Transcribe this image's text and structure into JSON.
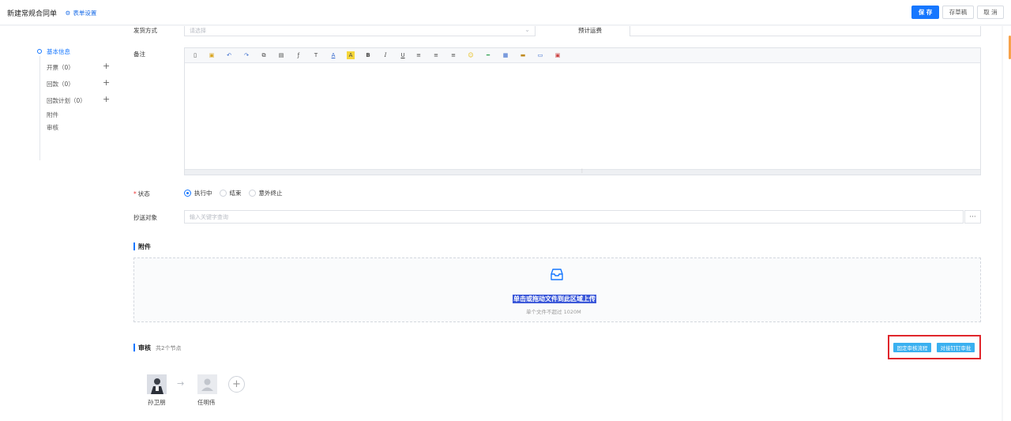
{
  "header": {
    "title": "新建常规合同单",
    "settings_link": "表单设置",
    "save_label": "保 存",
    "draft_label": "存草稿",
    "cancel_label": "取 消"
  },
  "sidebar": {
    "items": [
      {
        "label": "基本信息",
        "active": true
      },
      {
        "label": "开票（0）",
        "addable": true
      },
      {
        "label": "回款（0）",
        "addable": true
      },
      {
        "label": "回款计划（0）",
        "addable": true
      },
      {
        "label": "附件"
      },
      {
        "label": "审核"
      }
    ]
  },
  "form": {
    "shipping_label": "发货方式",
    "shipping_placeholder": "请选择",
    "estimate_label": "预计运费",
    "remark_label": "备注",
    "status_label": "状态",
    "status_options": [
      "执行中",
      "结束",
      "意外终止"
    ],
    "status_selected": "执行中",
    "cc_label": "抄送对象",
    "cc_placeholder": "输入关键字查询",
    "more_glyph": "···"
  },
  "attachment": {
    "title": "附件",
    "upload_text": "单击或拖动文件到此区域上传",
    "upload_hint": "单个文件不超过 1020M"
  },
  "review": {
    "title": "审核",
    "node_count": "共2个节点",
    "btn_fixed": "固定审核流程",
    "btn_free": "对接钉钉审批",
    "people": [
      "孙卫朋",
      "任明伟"
    ]
  },
  "colors": {
    "primary": "#1677ff",
    "highlight_box": "#e0262c",
    "secondary_button": "#3ab0f0"
  }
}
